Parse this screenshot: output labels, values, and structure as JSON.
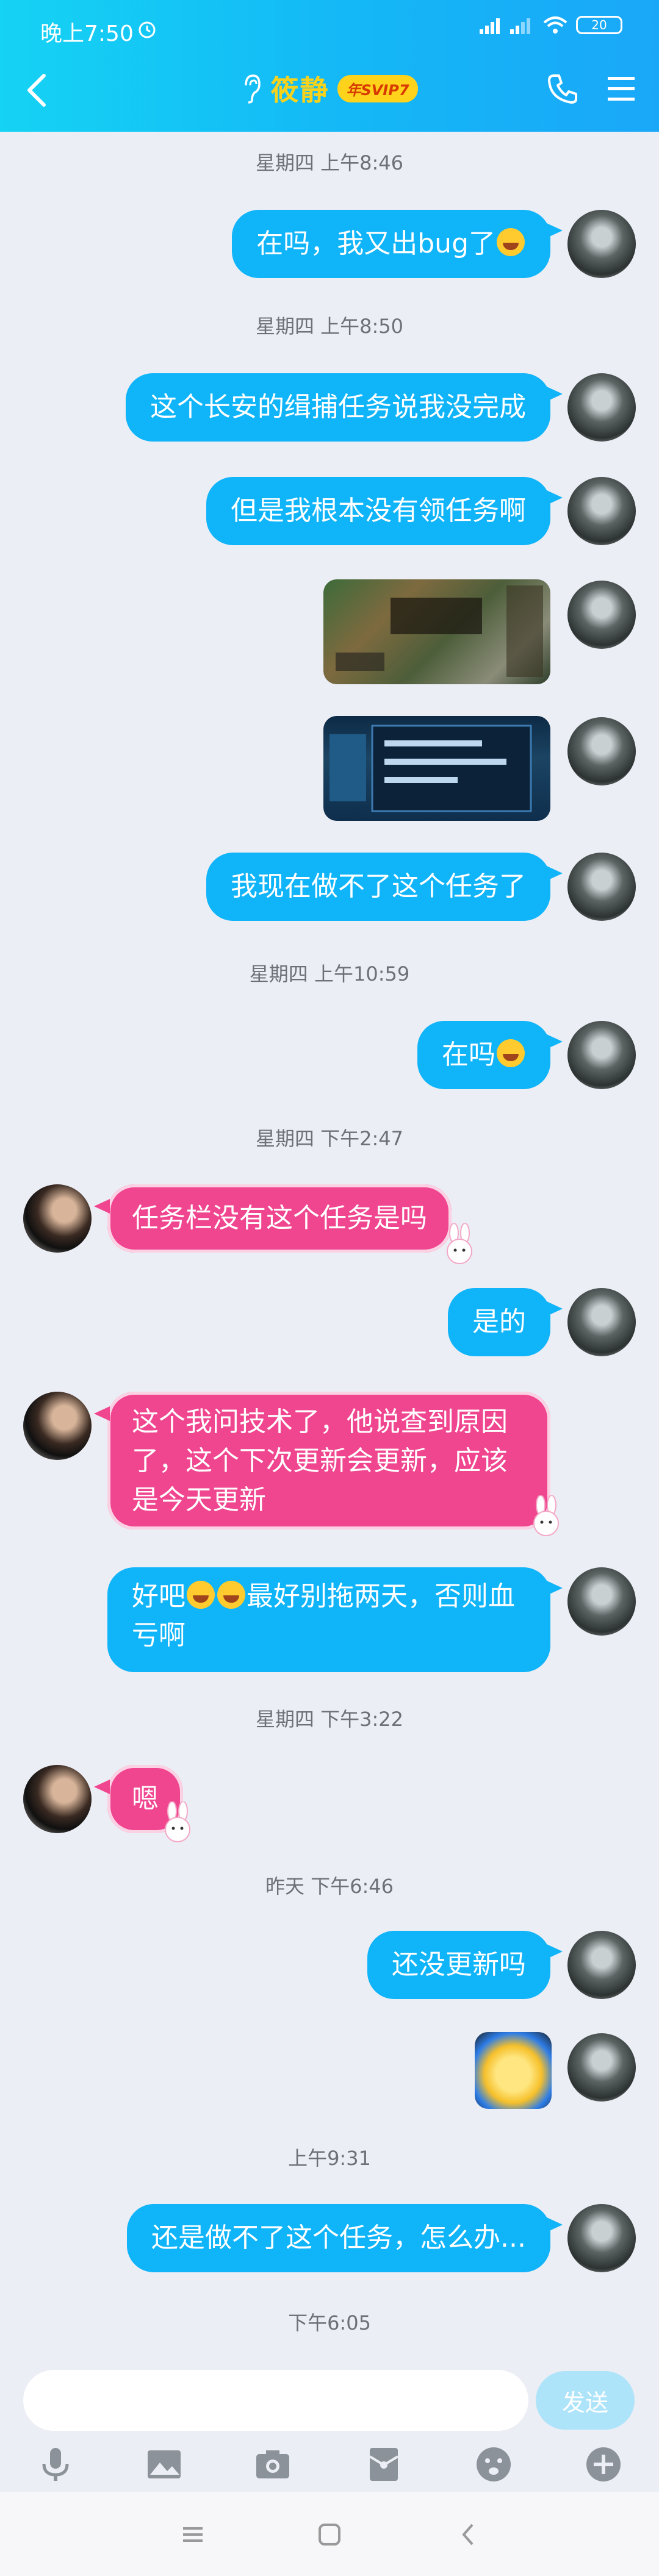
{
  "status_bar": {
    "time": "晚上7:50",
    "battery": "20"
  },
  "header": {
    "title": "筱静",
    "badge": "年SVIP7"
  },
  "messages": {
    "ts1": "星期四 上午8:46",
    "m1": "在吗，我又出bug了",
    "ts2": "星期四 上午8:50",
    "m2": "这个长安的缉捕任务说我没完成",
    "m3": "但是我根本没有领任务啊",
    "m4": "我现在做不了这个任务了",
    "ts3": "星期四 上午10:59",
    "m5": "在吗",
    "ts4": "星期四 下午2:47",
    "m6": "任务栏没有这个任务是吗",
    "m7": "是的",
    "m8": "这个我问技术了，他说查到原因了，这个下次更新会更新，应该是今天更新",
    "m9a": "好吧",
    "m9b": "最好别拖两天，否则血亏啊",
    "ts5": "星期四 下午3:22",
    "m10": "嗯",
    "ts6": "昨天 下午6:46",
    "m11": "还没更新吗",
    "ts7": "上午9:31",
    "m12": "还是做不了这个任务，怎么办...",
    "ts8": "下午6:05"
  },
  "input": {
    "placeholder": "",
    "send_label": "发送"
  },
  "icons": [
    "back-icon",
    "ear-icon",
    "phone-icon",
    "menu-icon",
    "microphone-icon",
    "image-icon",
    "camera-icon",
    "red-packet-icon",
    "emoji-icon",
    "plus-icon"
  ],
  "colors": {
    "header_start": "#15d3f4",
    "my_bubble": "#10b4f9",
    "other_bubble": "#f0458f",
    "background": "#eceef5"
  }
}
